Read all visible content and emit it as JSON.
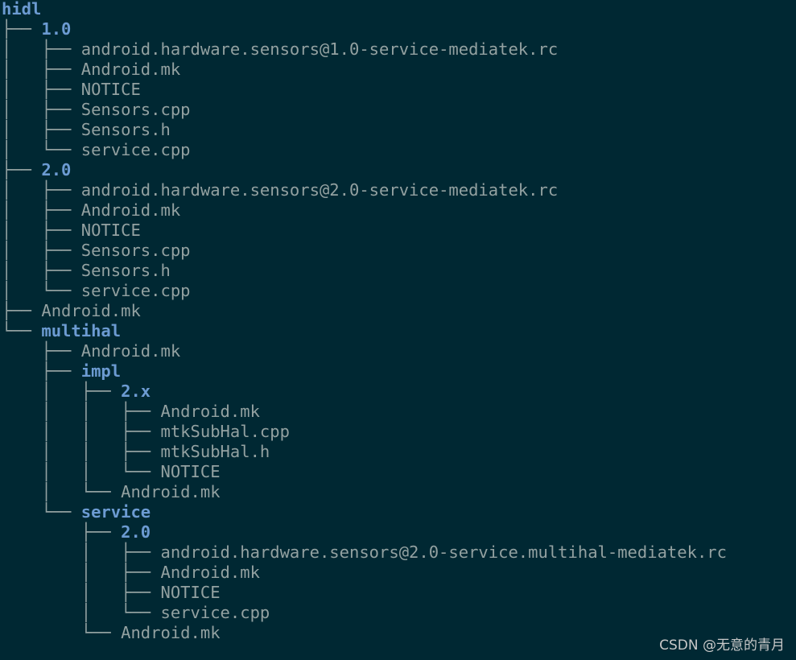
{
  "colors": {
    "background": "#002833",
    "directory": "#6c9bd2",
    "file": "#93a1a1",
    "tree_lines": "#93a1a1",
    "watermark": "#c8c8c8"
  },
  "tree": [
    {
      "prefix": "",
      "name": "hidl",
      "type": "dir"
    },
    {
      "prefix": "├── ",
      "name": "1.0",
      "type": "dir"
    },
    {
      "prefix": "│   ├── ",
      "name": "android.hardware.sensors@1.0-service-mediatek.rc",
      "type": "file"
    },
    {
      "prefix": "│   ├── ",
      "name": "Android.mk",
      "type": "file"
    },
    {
      "prefix": "│   ├── ",
      "name": "NOTICE",
      "type": "file"
    },
    {
      "prefix": "│   ├── ",
      "name": "Sensors.cpp",
      "type": "file"
    },
    {
      "prefix": "│   ├── ",
      "name": "Sensors.h",
      "type": "file"
    },
    {
      "prefix": "│   └── ",
      "name": "service.cpp",
      "type": "file"
    },
    {
      "prefix": "├── ",
      "name": "2.0",
      "type": "dir"
    },
    {
      "prefix": "│   ├── ",
      "name": "android.hardware.sensors@2.0-service-mediatek.rc",
      "type": "file"
    },
    {
      "prefix": "│   ├── ",
      "name": "Android.mk",
      "type": "file"
    },
    {
      "prefix": "│   ├── ",
      "name": "NOTICE",
      "type": "file"
    },
    {
      "prefix": "│   ├── ",
      "name": "Sensors.cpp",
      "type": "file"
    },
    {
      "prefix": "│   ├── ",
      "name": "Sensors.h",
      "type": "file"
    },
    {
      "prefix": "│   └── ",
      "name": "service.cpp",
      "type": "file"
    },
    {
      "prefix": "├── ",
      "name": "Android.mk",
      "type": "file"
    },
    {
      "prefix": "└── ",
      "name": "multihal",
      "type": "dir"
    },
    {
      "prefix": "    ├── ",
      "name": "Android.mk",
      "type": "file"
    },
    {
      "prefix": "    ├── ",
      "name": "impl",
      "type": "dir"
    },
    {
      "prefix": "    │   ├── ",
      "name": "2.x",
      "type": "dir"
    },
    {
      "prefix": "    │   │   ├── ",
      "name": "Android.mk",
      "type": "file"
    },
    {
      "prefix": "    │   │   ├── ",
      "name": "mtkSubHal.cpp",
      "type": "file"
    },
    {
      "prefix": "    │   │   ├── ",
      "name": "mtkSubHal.h",
      "type": "file"
    },
    {
      "prefix": "    │   │   └── ",
      "name": "NOTICE",
      "type": "file"
    },
    {
      "prefix": "    │   └── ",
      "name": "Android.mk",
      "type": "file"
    },
    {
      "prefix": "    └── ",
      "name": "service",
      "type": "dir"
    },
    {
      "prefix": "        ├── ",
      "name": "2.0",
      "type": "dir"
    },
    {
      "prefix": "        │   ├── ",
      "name": "android.hardware.sensors@2.0-service.multihal-mediatek.rc",
      "type": "file"
    },
    {
      "prefix": "        │   ├── ",
      "name": "Android.mk",
      "type": "file"
    },
    {
      "prefix": "        │   ├── ",
      "name": "NOTICE",
      "type": "file"
    },
    {
      "prefix": "        │   └── ",
      "name": "service.cpp",
      "type": "file"
    },
    {
      "prefix": "        └── ",
      "name": "Android.mk",
      "type": "file"
    }
  ],
  "watermark": "CSDN @无意的青月"
}
